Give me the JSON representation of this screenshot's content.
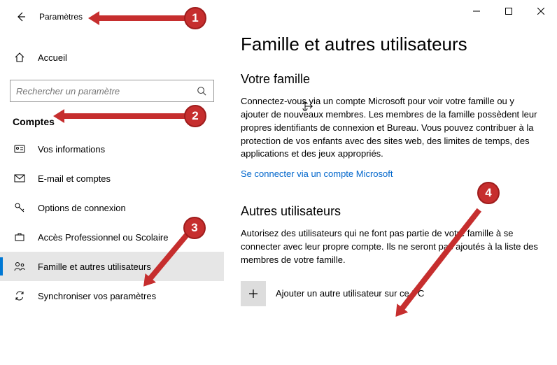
{
  "header": {
    "title": "Paramètres"
  },
  "home": {
    "label": "Accueil"
  },
  "search": {
    "placeholder": "Rechercher un paramètre"
  },
  "category": "Comptes",
  "nav": [
    {
      "label": "Vos informations"
    },
    {
      "label": "E-mail et comptes"
    },
    {
      "label": "Options de connexion"
    },
    {
      "label": "Accès Professionnel ou Scolaire"
    },
    {
      "label": "Famille et autres utilisateurs"
    },
    {
      "label": "Synchroniser vos paramètres"
    }
  ],
  "main": {
    "title": "Famille et autres utilisateurs",
    "family": {
      "heading": "Votre famille",
      "body": "Connectez-vous via un compte Microsoft pour voir votre famille ou y ajouter de nouveaux membres. Les membres de la famille possèdent leur propres identifiants de connexion et Bureau. Vous pouvez contribuer à la protection de vos enfants avec des sites web, des limites de temps, des applications et des jeux appropriés.",
      "link": "Se connecter via un compte Microsoft"
    },
    "others": {
      "heading": "Autres utilisateurs",
      "body": "Autorisez des utilisateurs qui ne font pas partie de votre famille à se connecter avec leur propre compte. Ils ne seront pas ajoutés à la liste des membres de votre famille.",
      "add_label": "Ajouter un autre utilisateur sur ce PC"
    }
  },
  "annotations": {
    "1": "1",
    "2": "2",
    "3": "3",
    "4": "4"
  }
}
